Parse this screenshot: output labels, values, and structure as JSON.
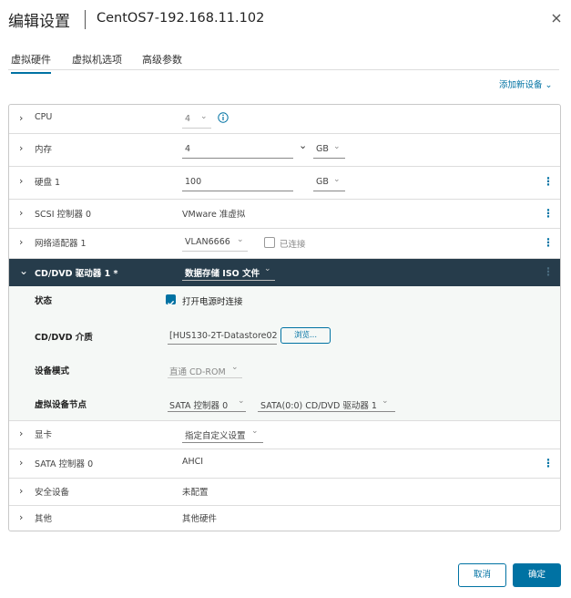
{
  "header": {
    "title": "编辑设置",
    "subtitle": "CentOS7-192.168.11.102"
  },
  "tabs": [
    {
      "label": "虚拟硬件"
    },
    {
      "label": "虚拟机选项"
    },
    {
      "label": "高级参数"
    }
  ],
  "add_device": "添加新设备",
  "rows": {
    "cpu": {
      "label": "CPU",
      "value": "4"
    },
    "memory": {
      "label": "内存",
      "value": "4",
      "unit": "GB"
    },
    "disk": {
      "label": "硬盘 1",
      "value": "100",
      "unit": "GB"
    },
    "scsi": {
      "label": "SCSI 控制器 0",
      "value": "VMware 准虚拟"
    },
    "network": {
      "label": "网络适配器 1",
      "value": "VLAN6666",
      "connected_label": "已连接"
    },
    "cddvd": {
      "label": "CD/DVD 驱动器 1 *",
      "value": "数据存储 ISO 文件"
    },
    "display": {
      "label": "显卡",
      "value": "指定自定义设置"
    },
    "sata": {
      "label": "SATA 控制器 0",
      "value": "AHCI"
    },
    "security": {
      "label": "安全设备",
      "value": "未配置"
    },
    "other": {
      "label": "其他",
      "value": "其他硬件"
    }
  },
  "cddvd_detail": {
    "status_label": "状态",
    "status_checkbox": "打开电源时连接",
    "media_label": "CD/DVD 介质",
    "media_value": "[HUS130-2T-Datastore02",
    "browse": "浏览...",
    "mode_label": "设备模式",
    "mode_value": "直通 CD-ROM",
    "node_label": "虚拟设备节点",
    "node_controller": "SATA 控制器 0",
    "node_value": "SATA(0:0) CD/DVD 驱动器 1"
  },
  "footer": {
    "cancel": "取消",
    "ok": "确定"
  },
  "colors": {
    "accent": "#0072a3",
    "dark_row": "#263c4b"
  }
}
